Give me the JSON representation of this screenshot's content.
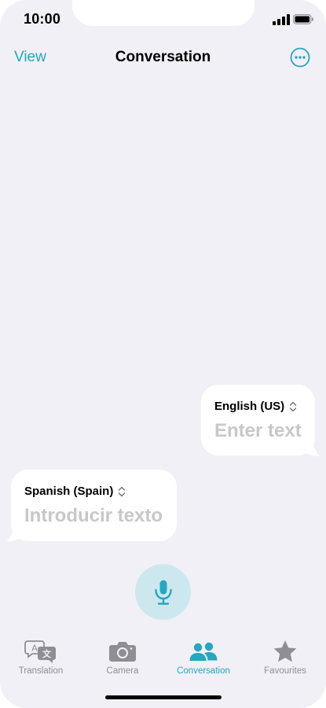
{
  "status_bar": {
    "time": "10:00"
  },
  "nav": {
    "view_label": "View",
    "title": "Conversation",
    "more_icon": "ellipsis-circle-icon"
  },
  "conversation": {
    "bubbles": [
      {
        "language": "English (US)",
        "placeholder": "Enter text"
      },
      {
        "language": "Spanish (Spain)",
        "placeholder": "Introducir texto"
      }
    ],
    "mic_icon": "microphone-icon"
  },
  "tab_bar": {
    "tabs": [
      {
        "label": "Translation",
        "icon": "translation-icon",
        "active": false
      },
      {
        "label": "Camera",
        "icon": "camera-icon",
        "active": false
      },
      {
        "label": "Conversation",
        "icon": "people-icon",
        "active": true
      },
      {
        "label": "Favourites",
        "icon": "star-icon",
        "active": false
      }
    ]
  },
  "colors": {
    "accent": "#27a6bf",
    "background": "#f1f0f6",
    "inactive": "#8e8e93",
    "placeholder": "#c7c7cc",
    "mic_bg": "#cde7ee"
  }
}
